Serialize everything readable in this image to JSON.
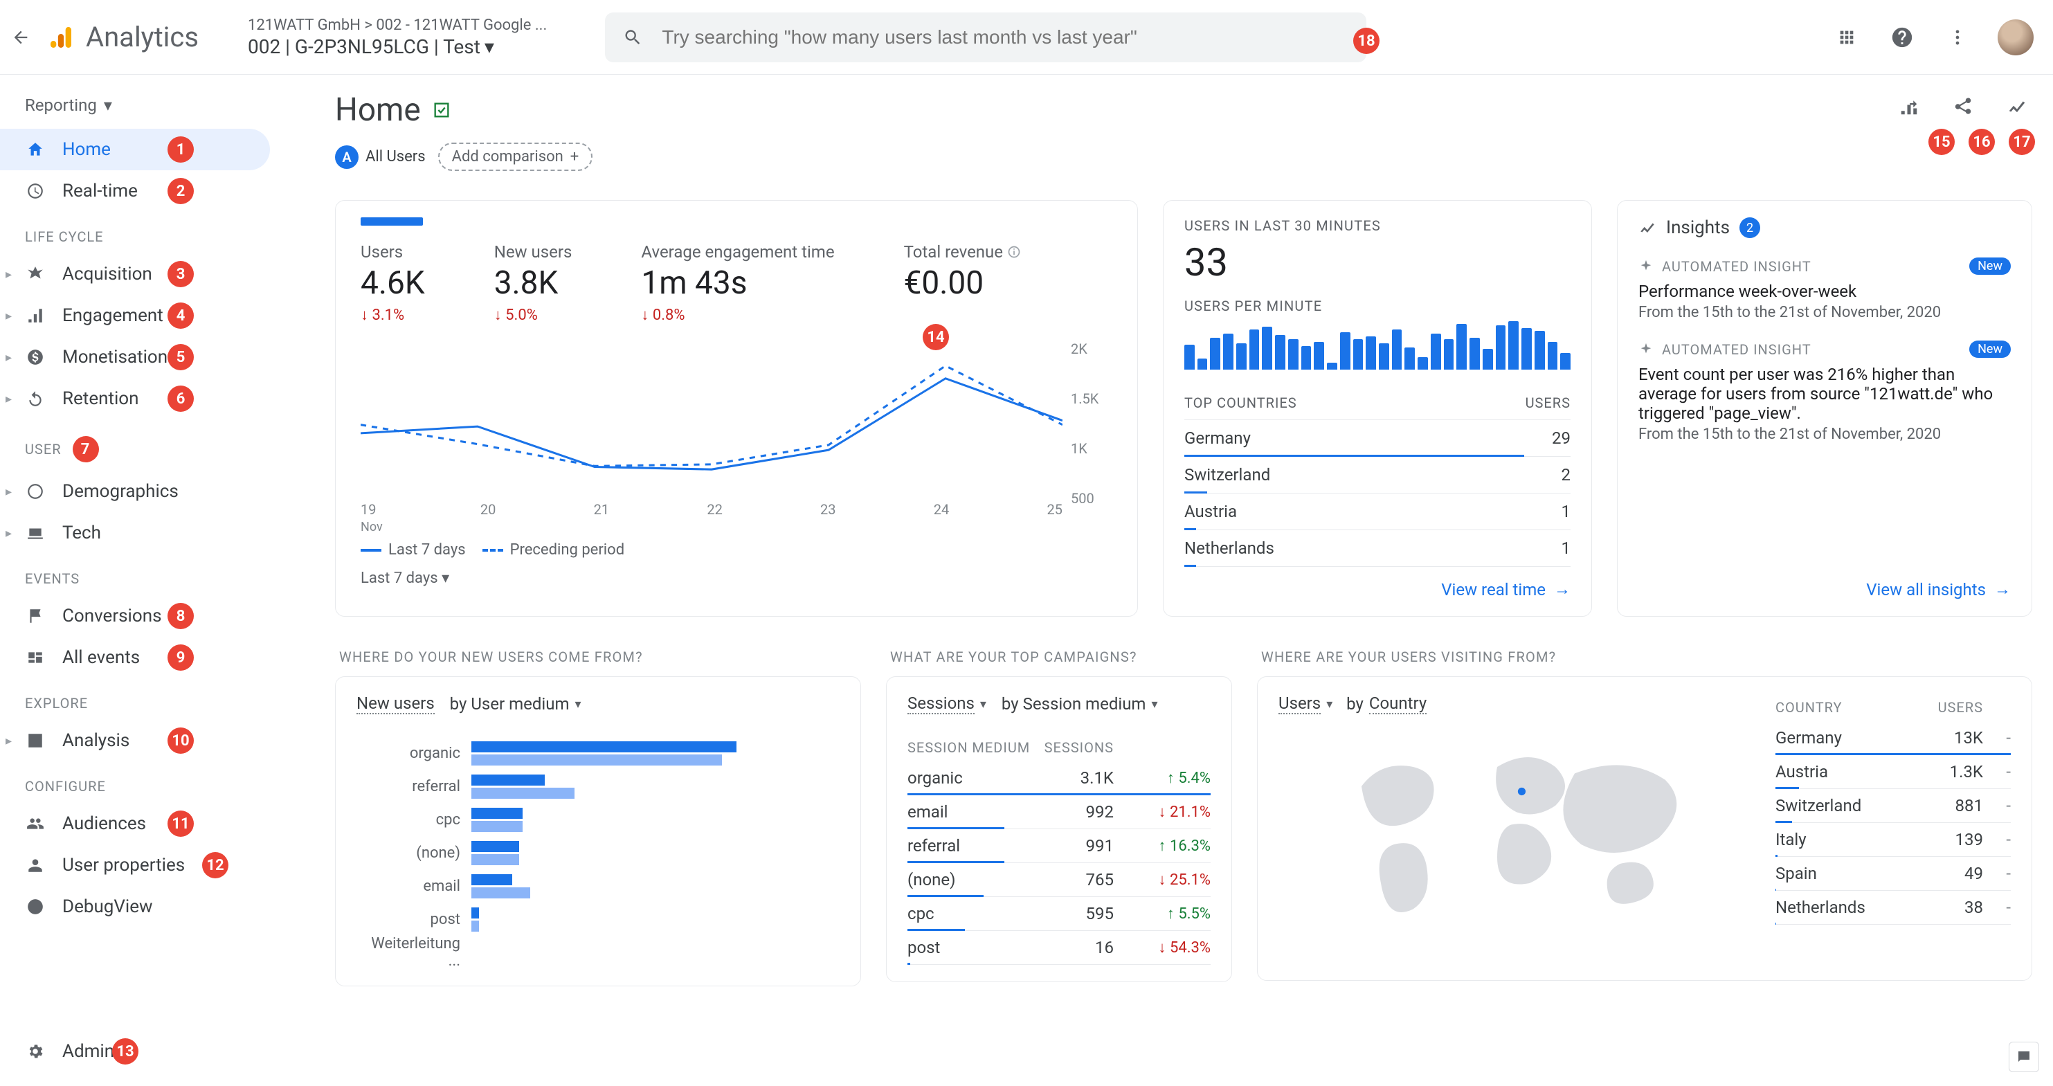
{
  "header": {
    "brand": "Analytics",
    "crumb": "121WATT GmbH > 002 - 121WATT Google ...",
    "property": "002 | G-2P3NL95LCG | Test",
    "search_placeholder": "Try searching \"how many users last month vs last year\""
  },
  "sidebar": {
    "reporting": "Reporting",
    "home": "Home",
    "realtime": "Real-time",
    "section_life": "LIFE CYCLE",
    "acquisition": "Acquisition",
    "engagement": "Engagement",
    "monetisation": "Monetisation",
    "retention": "Retention",
    "section_user": "USER",
    "demographics": "Demographics",
    "tech": "Tech",
    "section_events": "EVENTS",
    "conversions": "Conversions",
    "all_events": "All events",
    "section_explore": "EXPLORE",
    "analysis": "Analysis",
    "section_configure": "CONFIGURE",
    "audiences": "Audiences",
    "user_properties": "User properties",
    "debugview": "DebugView",
    "admin": "Admin"
  },
  "page": {
    "title": "Home",
    "all_users": "All Users",
    "add_comparison": "Add comparison"
  },
  "metrics": {
    "users_lbl": "Users",
    "users_val": "4.6K",
    "users_delta": "↓ 3.1%",
    "newusers_lbl": "New users",
    "newusers_val": "3.8K",
    "newusers_delta": "↓ 5.0%",
    "engage_lbl": "Average engagement time",
    "engage_val": "1m 43s",
    "engage_delta": "↓ 0.8%",
    "revenue_lbl": "Total revenue",
    "revenue_val": "€0.00",
    "legend_a": "Last 7 days",
    "legend_b": "Preceding period",
    "period": "Last 7 days"
  },
  "realtime": {
    "lbl": "USERS IN LAST 30 MINUTES",
    "val": "33",
    "upm": "USERS PER MINUTE",
    "countries_lbl": "TOP COUNTRIES",
    "users_lbl": "USERS",
    "rows": [
      {
        "country": "Germany",
        "users": "29",
        "pct": 88
      },
      {
        "country": "Switzerland",
        "users": "2",
        "pct": 6
      },
      {
        "country": "Austria",
        "users": "1",
        "pct": 3
      },
      {
        "country": "Netherlands",
        "users": "1",
        "pct": 3
      }
    ],
    "link": "View real time"
  },
  "insights": {
    "title": "Insights",
    "count": "2",
    "kind": "AUTOMATED INSIGHT",
    "new": "New",
    "a_title": "Performance week-over-week",
    "a_sub": "From the 15th to the 21st of November, 2020",
    "b_title": "Event count per user was 216% higher than average for users from source \"121watt.de\" who triggered \"page_view\".",
    "b_sub": "From the 15th to the 21st of November, 2020",
    "link": "View all insights"
  },
  "section_titles": {
    "a": "WHERE DO YOUR NEW USERS COME FROM?",
    "b": "WHAT ARE YOUR TOP CAMPAIGNS?",
    "c": "WHERE ARE YOUR USERS VISITING FROM?"
  },
  "medium_card": {
    "metric": "New users",
    "by": "by User medium",
    "rows": [
      "organic",
      "referral",
      "cpc",
      "(none)",
      "email",
      "post",
      "Weiterleitung ..."
    ]
  },
  "sessions_card": {
    "metric": "Sessions",
    "by": "by Session medium",
    "hdr_a": "SESSION MEDIUM",
    "hdr_b": "SESSIONS",
    "rows": [
      {
        "k": "organic",
        "v": "3.1K",
        "d": "↑ 5.4%",
        "up": true,
        "pct": 100
      },
      {
        "k": "email",
        "v": "992",
        "d": "↓ 21.1%",
        "up": false,
        "pct": 32
      },
      {
        "k": "referral",
        "v": "991",
        "d": "↑ 16.3%",
        "up": true,
        "pct": 32
      },
      {
        "k": "(none)",
        "v": "765",
        "d": "↓ 25.1%",
        "up": false,
        "pct": 25
      },
      {
        "k": "cpc",
        "v": "595",
        "d": "↑ 5.5%",
        "up": true,
        "pct": 19
      },
      {
        "k": "post",
        "v": "16",
        "d": "↓ 54.3%",
        "up": false,
        "pct": 1
      }
    ]
  },
  "geo_card": {
    "metric": "Users",
    "by": "by Country",
    "hdr_a": "COUNTRY",
    "hdr_b": "USERS",
    "rows": [
      {
        "k": "Germany",
        "v": "13K",
        "pct": 100
      },
      {
        "k": "Austria",
        "v": "1.3K",
        "pct": 10
      },
      {
        "k": "Switzerland",
        "v": "881",
        "pct": 7
      },
      {
        "k": "Italy",
        "v": "139",
        "pct": 1
      },
      {
        "k": "Spain",
        "v": "49",
        "pct": 0.4
      },
      {
        "k": "Netherlands",
        "v": "38",
        "pct": 0.3
      }
    ]
  },
  "annotations": {
    "1": "1",
    "2": "2",
    "3": "3",
    "4": "4",
    "5": "5",
    "6": "6",
    "7": "7",
    "8": "8",
    "9": "9",
    "10": "10",
    "11": "11",
    "12": "12",
    "13": "13",
    "14": "14",
    "15": "15",
    "16": "16",
    "17": "17",
    "18": "18"
  },
  "chart_data": {
    "type": "line",
    "x": [
      "19",
      "20",
      "21",
      "22",
      "23",
      "24",
      "25"
    ],
    "x_sublabel": "Nov",
    "series": [
      {
        "name": "Last 7 days",
        "values": [
          900,
          980,
          500,
          470,
          700,
          1550,
          1050
        ],
        "style": "solid"
      },
      {
        "name": "Preceding period",
        "values": [
          1000,
          770,
          510,
          530,
          760,
          1700,
          1000
        ],
        "style": "dashed"
      }
    ],
    "ylim": [
      0,
      2000
    ],
    "yticks": [
      "2K",
      "1.5K",
      "1K",
      "500"
    ],
    "realtime_bars": [
      45,
      20,
      58,
      65,
      48,
      72,
      78,
      62,
      55,
      42,
      50,
      12,
      68,
      55,
      60,
      48,
      72,
      40,
      22,
      65,
      55,
      82,
      58,
      38,
      80,
      88,
      75,
      70,
      50,
      30
    ]
  },
  "medium_bars": {
    "organic": {
      "a": 72,
      "b": 68
    },
    "referral": {
      "a": 20,
      "b": 28
    },
    "cpc": {
      "a": 14,
      "b": 14
    },
    "(none)": {
      "a": 13,
      "b": 13
    },
    "email": {
      "a": 11,
      "b": 16
    },
    "post": {
      "a": 2,
      "b": 2
    },
    "Weiterleitung ...": {
      "a": 0,
      "b": 0
    }
  }
}
